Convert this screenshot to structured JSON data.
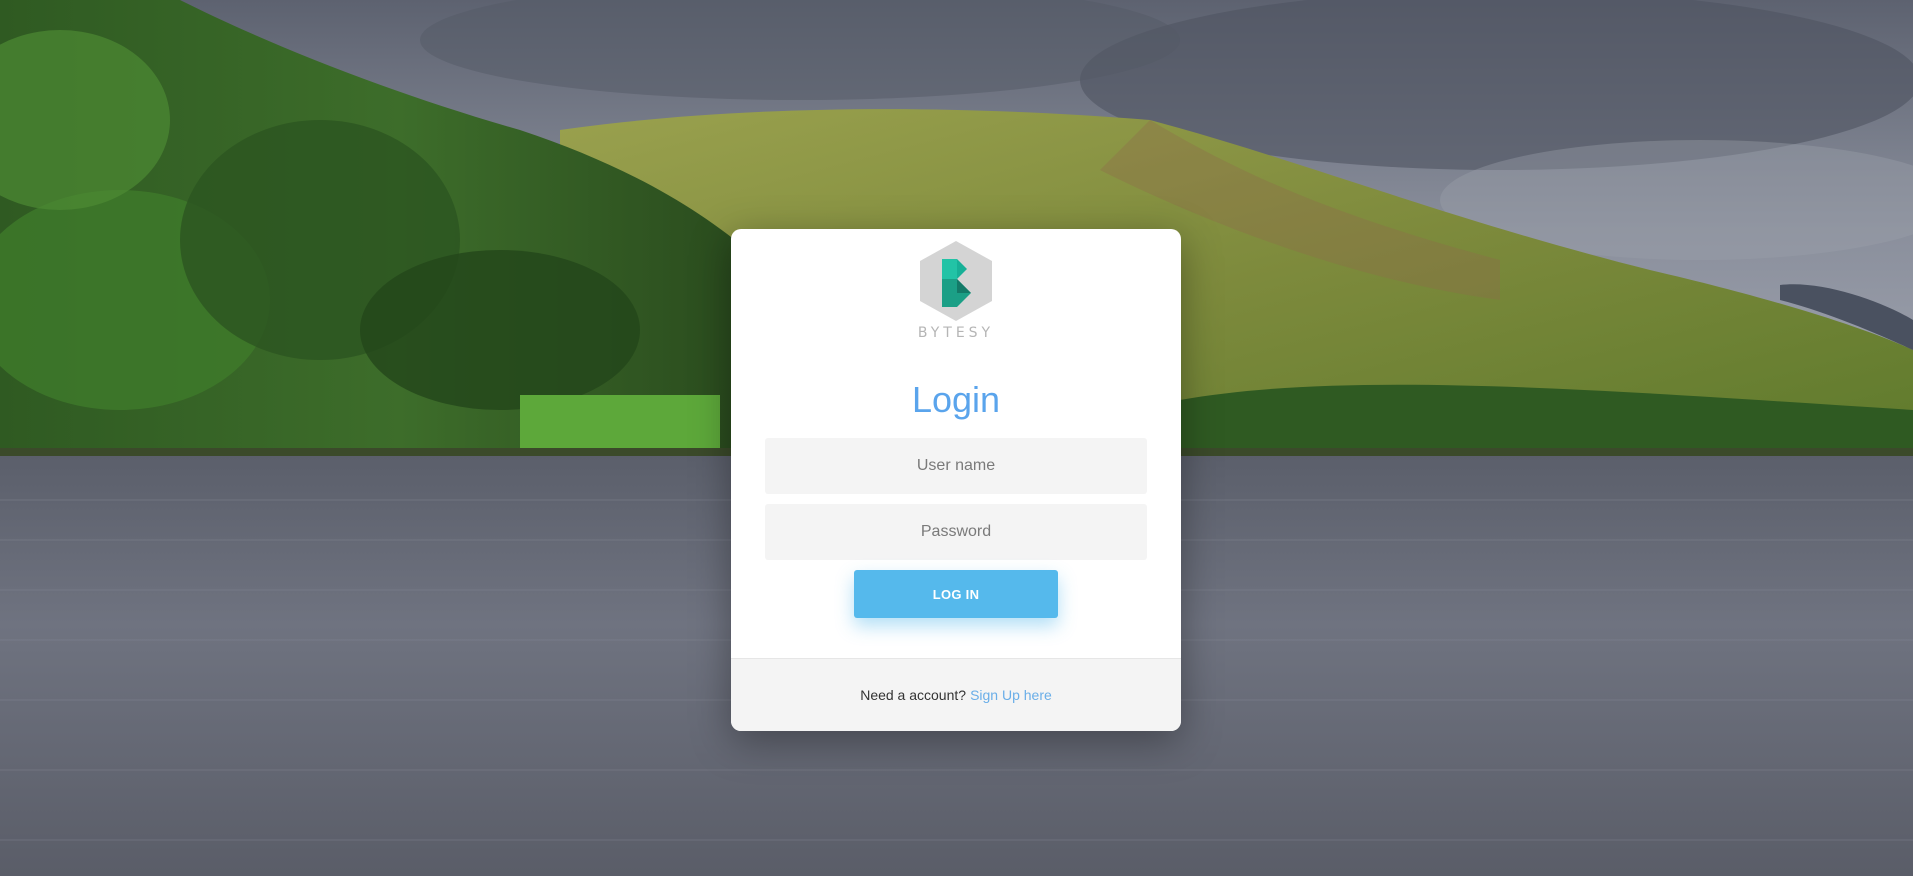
{
  "brand": {
    "name": "BYTESY",
    "logo_icon": "bytesy-hexagon-logo-icon"
  },
  "login": {
    "title": "Login",
    "username_placeholder": "User name",
    "password_placeholder": "Password",
    "submit_label": "LOG IN"
  },
  "footer": {
    "prompt": "Need a account?",
    "signup_link": "Sign Up here"
  },
  "colors": {
    "accent": "#5aa4ec",
    "button": "#55b9ec",
    "link": "#6aaee8"
  }
}
